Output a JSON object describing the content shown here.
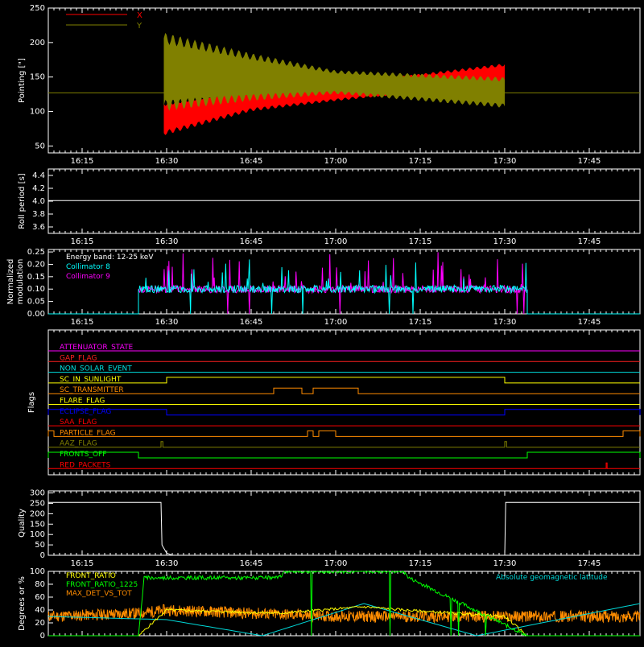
{
  "time_axis": {
    "ticks": [
      "16:15",
      "16:30",
      "16:45",
      "17:00",
      "17:15",
      "17:30",
      "17:45"
    ]
  },
  "colors": {
    "X": "#ff0000",
    "Y": "#808000",
    "collimator8": "#00ffff",
    "collimator9": "#ff00ff",
    "front_ratio": "#ffff00",
    "front_ratio_1225": "#00ff00",
    "max_det": "#ff8c00",
    "geomag": "#00d8d8"
  },
  "panels": {
    "pointing": {
      "ylabel": "Pointing [\"]",
      "yticks": [
        "50",
        "100",
        "150",
        "200",
        "250"
      ],
      "legend": [
        {
          "name": "X",
          "color": "#ff0000"
        },
        {
          "name": "Y",
          "color": "#808000"
        }
      ]
    },
    "roll": {
      "ylabel": "Roll period [s]",
      "yticks": [
        "3.6",
        "3.8",
        "4.0",
        "4.2",
        "4.4"
      ]
    },
    "modulation": {
      "ylabel_1": "Normalized",
      "ylabel_2": "modulation",
      "yticks": [
        "0.00",
        "0.05",
        "0.10",
        "0.15",
        "0.20",
        "0.25"
      ],
      "annotation": "Energy band: 12-25 keV",
      "legend": [
        {
          "name": "Collimator 8",
          "color": "#00ffff"
        },
        {
          "name": "Collimator 9",
          "color": "#ff00ff"
        }
      ]
    },
    "flags": {
      "ylabel": "Flags",
      "items": [
        {
          "name": "ATTENUATOR_STATE",
          "color": "#ff00ff"
        },
        {
          "name": "GAP_FLAG",
          "color": "#ff2020"
        },
        {
          "name": "NON_SOLAR_EVENT",
          "color": "#00e0e0"
        },
        {
          "name": "SC_IN_SUNLIGHT",
          "color": "#ffff00"
        },
        {
          "name": "SC_TRANSMITTER",
          "color": "#ff8c00"
        },
        {
          "name": "FLARE_FLAG",
          "color": "#ffff00"
        },
        {
          "name": "ECLIPSE_FLAG",
          "color": "#0000ff"
        },
        {
          "name": "SAA_FLAG",
          "color": "#ff0000"
        },
        {
          "name": "PARTICLE_FLAG",
          "color": "#ff8c00"
        },
        {
          "name": "AAZ_FLAG",
          "color": "#808000"
        },
        {
          "name": "FRONTS_OFF",
          "color": "#00ff00"
        },
        {
          "name": "RED_PACKETS",
          "color": "#ff0000"
        }
      ]
    },
    "quality": {
      "ylabel": "Quality",
      "yticks": [
        "0",
        "50",
        "100",
        "150",
        "200",
        "250",
        "300"
      ]
    },
    "ratios": {
      "ylabel": "Degrees or %",
      "yticks": [
        "0",
        "20",
        "40",
        "60",
        "80",
        "100"
      ],
      "legend": [
        {
          "name": "FRONT_RATIO",
          "color": "#ffff00"
        },
        {
          "name": "FRONT_RATIO_1225",
          "color": "#00ff00"
        },
        {
          "name": "MAX_DET_VS_TOT",
          "color": "#ff8c00"
        }
      ],
      "right_label": {
        "name": "Absolute geomagnetic latitude",
        "color": "#00d8d8"
      }
    }
  },
  "chart_data": [
    {
      "type": "line",
      "ylabel": "Pointing [\"]",
      "ylim": [
        40,
        250
      ],
      "xlim": [
        "16:09",
        "17:54"
      ],
      "series": [
        {
          "name": "X",
          "x": [
            "16:09",
            "16:29",
            "16:29:30",
            "16:45",
            "17:00",
            "17:30",
            "17:30:10",
            "17:54"
          ],
          "y": [
            127,
            127,
            160,
            165,
            140,
            165,
            127,
            127
          ],
          "envelope_low": [
            127,
            127,
            65,
            100,
            115,
            140,
            127,
            127
          ],
          "envelope_high": [
            127,
            127,
            115,
            135,
            140,
            170,
            127,
            127
          ]
        },
        {
          "name": "Y",
          "x": [
            "16:09",
            "16:29",
            "16:29:30",
            "16:45",
            "17:00",
            "17:30",
            "17:30:10",
            "17:54"
          ],
          "y": [
            127,
            127,
            160,
            155,
            140,
            130,
            127,
            127
          ],
          "envelope_low": [
            127,
            127,
            100,
            115,
            125,
            105,
            127,
            127
          ],
          "envelope_high": [
            127,
            127,
            215,
            185,
            160,
            150,
            127,
            127
          ]
        }
      ]
    },
    {
      "type": "line",
      "ylabel": "Roll period [s]",
      "ylim": [
        3.5,
        4.5
      ],
      "series": [
        {
          "x": [
            "16:09",
            "17:54"
          ],
          "y": [
            4.01,
            4.01
          ]
        }
      ]
    },
    {
      "type": "line",
      "ylabel": "Normalized modulation",
      "ylim": [
        0,
        0.25
      ],
      "series": [
        {
          "name": "Collimator 8",
          "active": [
            "16:25",
            "17:34"
          ],
          "baseline": 0.1,
          "peak": 0.22
        },
        {
          "name": "Collimator 9",
          "active": [
            "16:25",
            "17:34"
          ],
          "baseline": 0.1,
          "peak": 0.25
        }
      ]
    },
    {
      "type": "line",
      "ylabel": "Flags",
      "series": [
        {
          "name": "ATTENUATOR_STATE",
          "on": []
        },
        {
          "name": "GAP_FLAG",
          "on": []
        },
        {
          "name": "NON_SOLAR_EVENT",
          "on": []
        },
        {
          "name": "SC_IN_SUNLIGHT",
          "on": [
            [
              "16:30",
              "17:30"
            ]
          ]
        },
        {
          "name": "SC_TRANSMITTER",
          "on": [
            [
              "16:49",
              "16:54"
            ],
            [
              "16:56",
              "17:04"
            ]
          ]
        },
        {
          "name": "FLARE_FLAG",
          "on": []
        },
        {
          "name": "ECLIPSE_FLAG",
          "on": [
            [
              "16:09",
              "16:30"
            ],
            [
              "17:30",
              "17:54"
            ]
          ]
        },
        {
          "name": "SAA_FLAG",
          "on": []
        },
        {
          "name": "PARTICLE_FLAG",
          "on": [
            [
              "16:09",
              "16:10"
            ],
            [
              "16:55",
              "16:56"
            ],
            [
              "16:57",
              "17:00"
            ],
            [
              "17:51",
              "17:54"
            ]
          ]
        },
        {
          "name": "AAZ_FLAG",
          "on": [
            [
              "16:29",
              "16:29:20"
            ],
            [
              "17:30",
              "17:30:20"
            ]
          ]
        },
        {
          "name": "FRONTS_OFF",
          "on": [
            [
              "16:09",
              "16:25"
            ],
            [
              "17:34",
              "17:54"
            ]
          ]
        },
        {
          "name": "RED_PACKETS",
          "on": [
            [
              "17:48",
              "17:48:10"
            ]
          ]
        }
      ]
    },
    {
      "type": "line",
      "ylabel": "Quality",
      "ylim": [
        0,
        300
      ],
      "series": [
        {
          "x": [
            "16:09",
            "16:29",
            "16:29:10",
            "16:30",
            "16:31",
            "17:30",
            "17:30:10",
            "17:54"
          ],
          "y": [
            255,
            255,
            50,
            10,
            0,
            0,
            255,
            255
          ]
        }
      ]
    },
    {
      "type": "line",
      "ylabel": "Degrees or %",
      "ylim": [
        0,
        100
      ],
      "series": [
        {
          "name": "FRONT_RATIO",
          "x": [
            "16:09",
            "16:25",
            "16:30",
            "16:50",
            "17:05",
            "17:12",
            "17:30",
            "17:34",
            "17:54"
          ],
          "y": [
            0,
            0,
            40,
            35,
            45,
            40,
            30,
            0,
            0
          ]
        },
        {
          "name": "FRONT_RATIO_1225",
          "x": [
            "16:09",
            "16:25",
            "16:26",
            "16:50",
            "16:51",
            "17:12",
            "17:13",
            "17:34",
            "17:54"
          ],
          "y": [
            0,
            0,
            90,
            90,
            100,
            100,
            90,
            0,
            0
          ]
        },
        {
          "name": "MAX_DET_VS_TOT",
          "x": [
            "16:09",
            "16:25",
            "16:30",
            "17:00",
            "17:30",
            "17:54"
          ],
          "y": [
            30,
            35,
            40,
            30,
            30,
            30
          ]
        },
        {
          "name": "Absolute geomagnetic latitude",
          "x": [
            "16:09",
            "16:30",
            "16:47",
            "17:05",
            "17:25",
            "17:54"
          ],
          "y": [
            30,
            25,
            0,
            50,
            0,
            50
          ]
        }
      ]
    }
  ]
}
